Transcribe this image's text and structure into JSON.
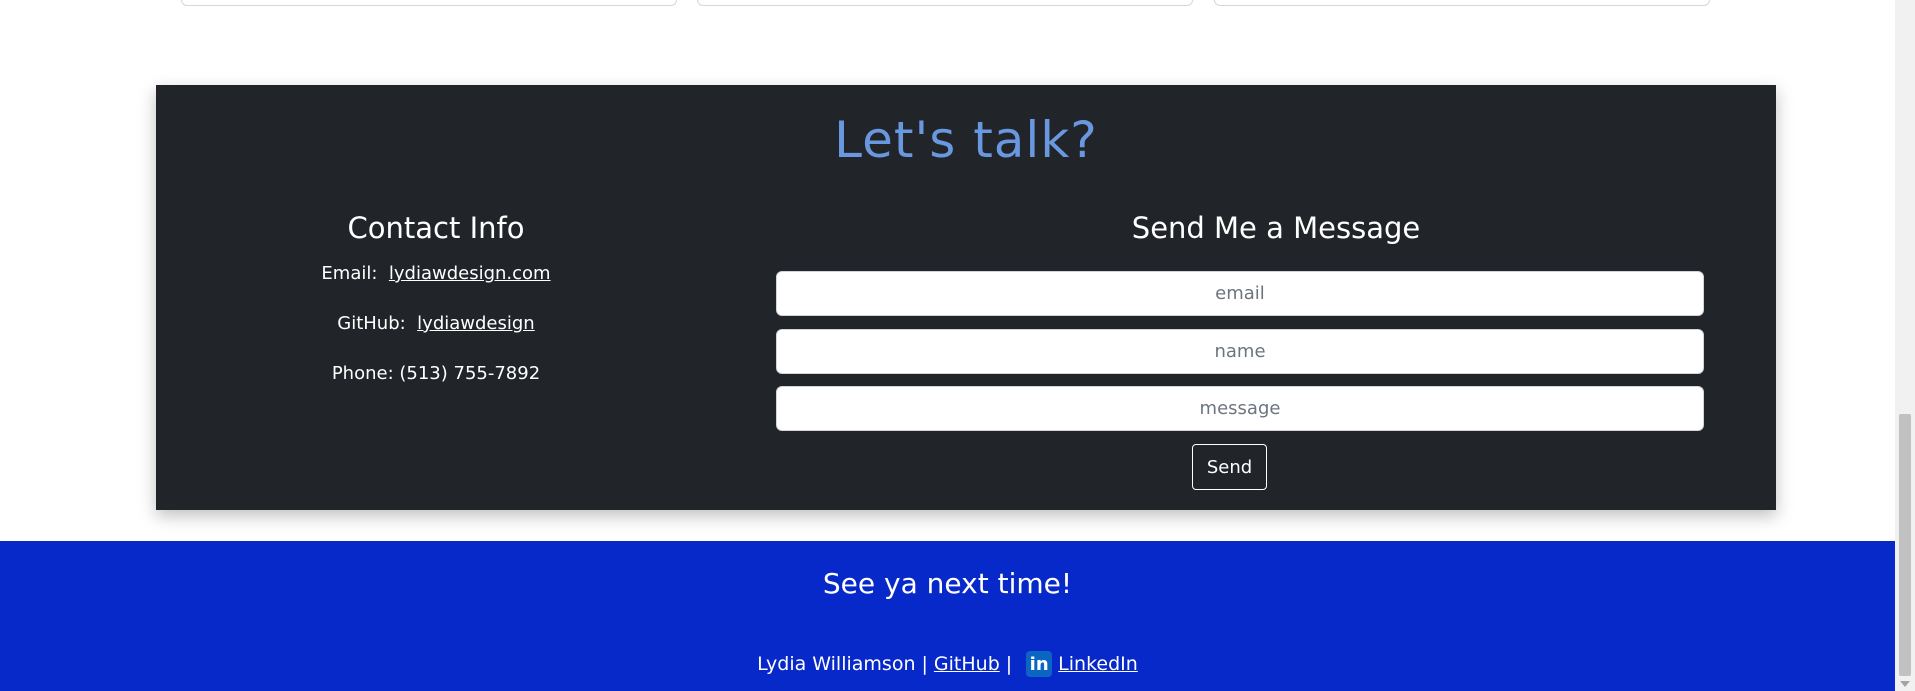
{
  "contact": {
    "title": "Let's talk?",
    "info_heading": "Contact Info",
    "email_label": "Email:",
    "email_value": "lydiawdesign.com",
    "github_label": "GitHub:",
    "github_value": "lydiawdesign",
    "phone_text": "Phone: (513) 755-7892",
    "form_heading": "Send Me a Message",
    "email_placeholder": "email",
    "name_placeholder": "name",
    "message_placeholder": "message",
    "send_label": "Send"
  },
  "footer": {
    "title": "See ya next time!",
    "author": "Lydia Williamson |",
    "github_link": "GitHub",
    "separator": "|",
    "linkedin_icon_letter": "in",
    "linkedin_link": "LinkedIn"
  },
  "colors": {
    "contact_bg": "#212529",
    "title_accent": "#6a98e0",
    "footer_bg": "#0729c9",
    "linkedin_blue": "#0a66c2"
  },
  "icons": {
    "linkedin": "linkedin-icon",
    "scroll_down": "scroll-down-arrow"
  }
}
